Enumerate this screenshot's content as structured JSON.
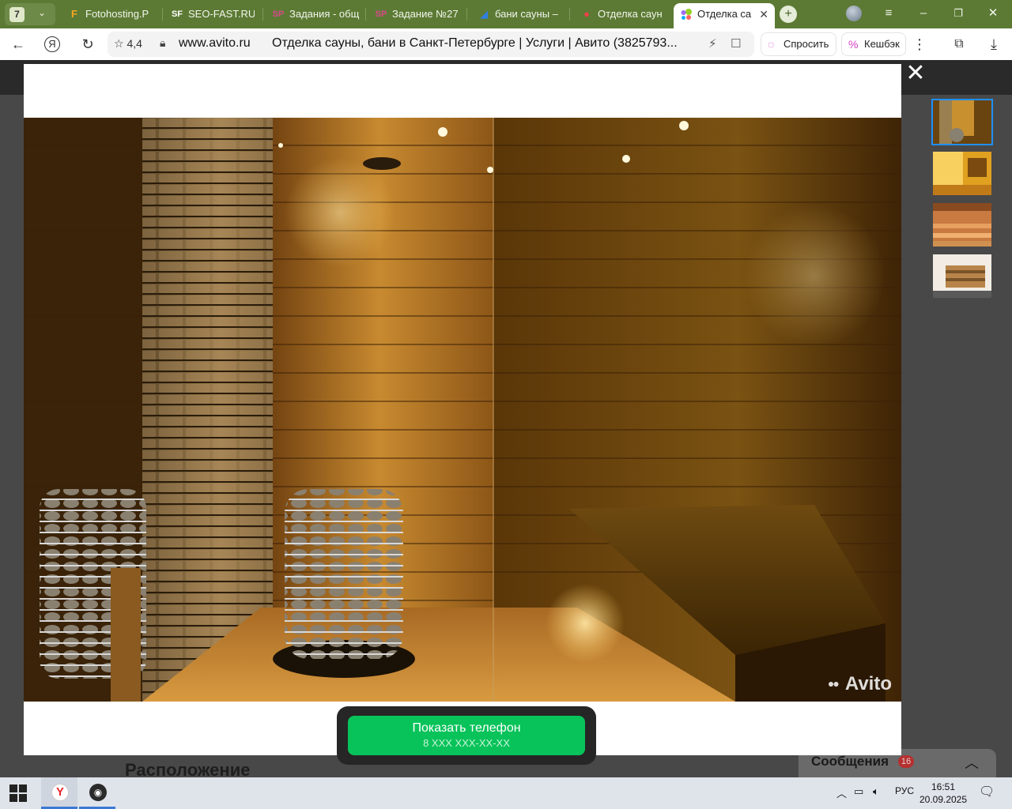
{
  "browser": {
    "tab_count": "7",
    "tabs": [
      {
        "label": "Fotohosting.P",
        "icon": "F",
        "icon_color": "#f5a623"
      },
      {
        "label": "SEO-FAST.RU",
        "icon": "SF",
        "icon_color": "#ffffff"
      },
      {
        "label": "Задания - общ",
        "icon": "SP",
        "icon_color": "#d84a8a"
      },
      {
        "label": "Задание №27",
        "icon": "SP",
        "icon_color": "#d84a8a"
      },
      {
        "label": "бани сауны –",
        "icon": "◢",
        "icon_color": "#2f7fe0"
      },
      {
        "label": "Отделка саун",
        "icon": "●",
        "icon_color": "#e8434a"
      },
      {
        "label": "Отделка са",
        "icon": "●",
        "icon_color": "#2fa5e8"
      }
    ],
    "new_tab": "+",
    "address": {
      "rating": "4,4",
      "domain": "www.avito.ru",
      "title": "Отделка сауны, бани в Санкт-Петербурге | Услуги | Авито (3825793..."
    },
    "ask_label": "Спросить",
    "cashback_label": "Кешбэк"
  },
  "gallery": {
    "watermark": "Avito",
    "thumbnail_count": 4,
    "selected_thumbnail": 1,
    "phone_button": {
      "label": "Показать телефон",
      "number_mask": "8 XXX XXX-XX-XX"
    }
  },
  "page": {
    "location_heading": "Расположение",
    "messages_label": "Сообщения",
    "messages_badge": "16"
  },
  "taskbar": {
    "language": "РУС",
    "time": "16:51",
    "date": "20.09.2025"
  },
  "colors": {
    "tabbar": "#5c7a34",
    "avito_green": "#08c35a",
    "thumb_selected": "#1e90ff"
  }
}
